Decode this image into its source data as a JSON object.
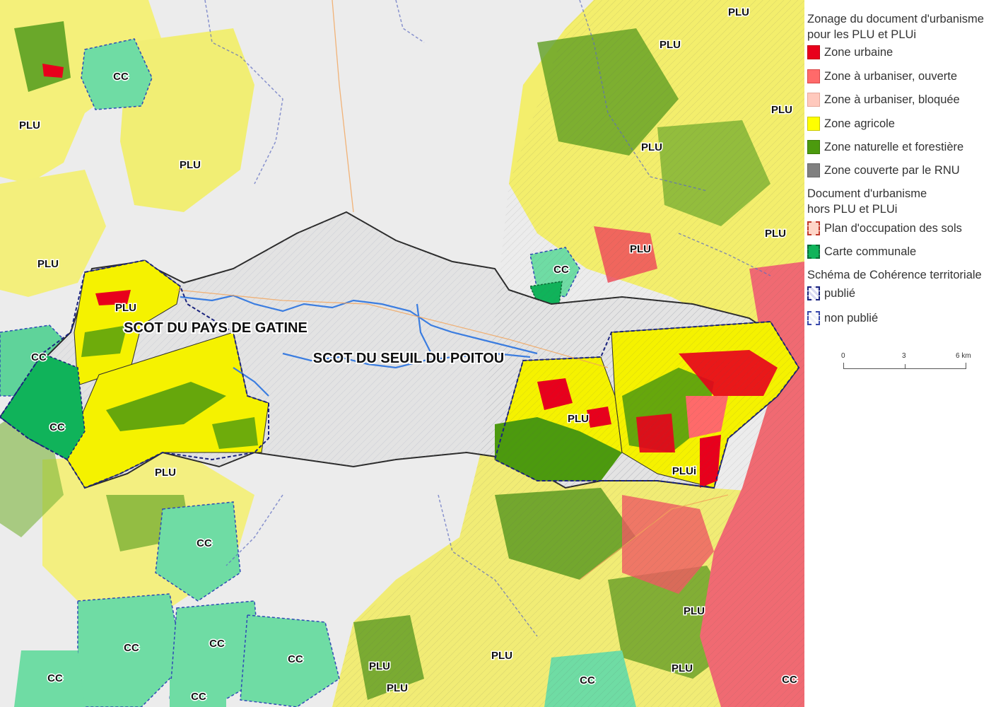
{
  "legend": {
    "title1": "Zonage du document d'urbanisme\npour les PLU et PLUi",
    "zones": [
      {
        "label": "Zone urbaine",
        "color": "#e8001c",
        "border": "#c00010"
      },
      {
        "label": "Zone à urbaniser, ouverte",
        "color": "#ff6a6a",
        "border": "#d84848"
      },
      {
        "label": "Zone à urbaniser, bloquée",
        "color": "#ffc9bd",
        "border": "#e6a89a"
      },
      {
        "label": "Zone agricole",
        "color": "#ffff00",
        "border": "#c8c800"
      },
      {
        "label": "Zone naturelle et forestière",
        "color": "#4c9a0e",
        "border": "#3b7a08"
      },
      {
        "label": "Zone couverte par le RNU",
        "color": "#808080",
        "border": "#666666"
      }
    ],
    "title2": "Document d'urbanisme\nhors PLU et PLUi",
    "docs": [
      {
        "label": "Plan d'occupation des sols",
        "color": "#ffd6c8",
        "border": "#c0392b"
      },
      {
        "label": "Carte communale",
        "color": "#10b35a",
        "border": "#0b6b36"
      }
    ],
    "title3": "Schéma de Cohérence territoriale",
    "scot": [
      {
        "label": "publié",
        "color": "#d9d9f2",
        "border": "#1a237e"
      },
      {
        "label": "non publié",
        "color": "#eef0f8",
        "border": "#3949ab"
      }
    ],
    "scale": {
      "t0": "0",
      "t1": "3",
      "t2": "6 km"
    }
  },
  "map": {
    "scot_labels": [
      "SCOT DU PAYS DE GATINE",
      "SCOT DU SEUIL DU POITOU"
    ],
    "labels": [
      {
        "text": "PLU",
        "kind": "plu"
      },
      {
        "text": "PLU",
        "kind": "plu"
      },
      {
        "text": "PLU",
        "kind": "plu"
      },
      {
        "text": "PLU",
        "kind": "plu"
      },
      {
        "text": "PLU",
        "kind": "plu"
      },
      {
        "text": "PLU",
        "kind": "plu"
      },
      {
        "text": "PLU",
        "kind": "plu"
      },
      {
        "text": "PLU",
        "kind": "plu"
      },
      {
        "text": "PLU",
        "kind": "plu"
      },
      {
        "text": "PLU",
        "kind": "plu"
      },
      {
        "text": "PLU",
        "kind": "plu"
      },
      {
        "text": "PLU",
        "kind": "plu"
      },
      {
        "text": "PLU",
        "kind": "plu"
      },
      {
        "text": "PLU",
        "kind": "plu"
      },
      {
        "text": "PLU",
        "kind": "plu"
      },
      {
        "text": "PLU",
        "kind": "plu"
      },
      {
        "text": "PLU",
        "kind": "plu"
      },
      {
        "text": "PLUi",
        "kind": "plu"
      },
      {
        "text": "CC",
        "kind": "cc"
      },
      {
        "text": "CC",
        "kind": "cc"
      },
      {
        "text": "CC",
        "kind": "cc"
      },
      {
        "text": "CC",
        "kind": "cc"
      },
      {
        "text": "CC",
        "kind": "cc"
      },
      {
        "text": "CC",
        "kind": "cc"
      },
      {
        "text": "CC",
        "kind": "cc"
      },
      {
        "text": "CC",
        "kind": "cc"
      },
      {
        "text": "CC",
        "kind": "cc"
      },
      {
        "text": "CC",
        "kind": "cc"
      },
      {
        "text": "CC",
        "kind": "cc"
      },
      {
        "text": "CC",
        "kind": "cc"
      }
    ]
  }
}
